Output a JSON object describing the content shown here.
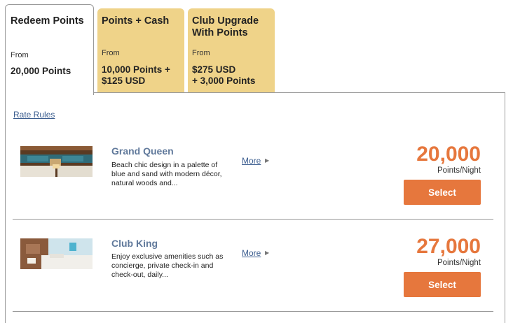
{
  "tabs": [
    {
      "title": "Redeem Points",
      "from": "From",
      "price": "20,000 Points"
    },
    {
      "title": "Points + Cash",
      "from": "From",
      "price_line1": "10,000 Points +",
      "price_line2": "$125 USD"
    },
    {
      "title_line1": "Club Upgrade",
      "title_line2": "With Points",
      "from": "From",
      "price_line1": "$275 USD",
      "price_line2": "+ 3,000 Points"
    }
  ],
  "rate_rules_label": "Rate Rules",
  "rooms": [
    {
      "name": "Grand Queen",
      "desc_line1": "Beach chic design in a palette of",
      "desc_line2": "blue and sand with modern décor,",
      "desc_line3": "natural woods and...",
      "more_label": "More",
      "price": "20,000",
      "unit": "Points/Night",
      "select_label": "Select"
    },
    {
      "name": "Club King",
      "desc_line1": "Enjoy exclusive amenities such as",
      "desc_line2": "concierge, private check-in and",
      "desc_line3": "check-out, daily...",
      "more_label": "More",
      "price": "27,000",
      "unit": "Points/Night",
      "select_label": "Select"
    }
  ],
  "colors": {
    "accent_orange": "#e6773d",
    "tab_inactive": "#efd389",
    "link_blue": "#3b5d8f",
    "room_name": "#60799b"
  }
}
